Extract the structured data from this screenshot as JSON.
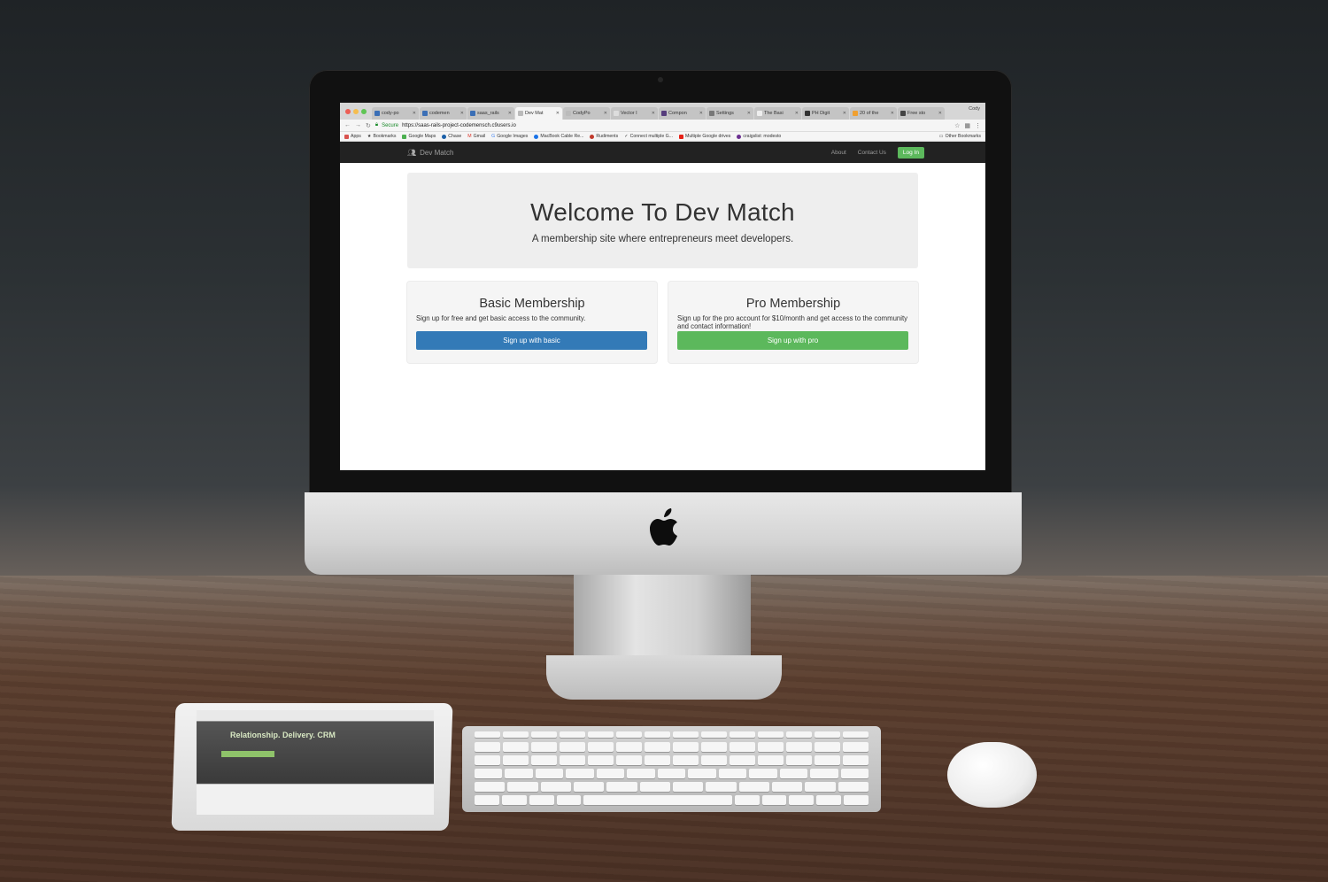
{
  "browser": {
    "tabs": [
      {
        "label": "cody-po",
        "active": false
      },
      {
        "label": "codemen",
        "active": false
      },
      {
        "label": "saas_rails",
        "active": false
      },
      {
        "label": "Dev Mat",
        "active": true
      },
      {
        "label": "CodyPo",
        "active": false
      },
      {
        "label": "Vector I",
        "active": false
      },
      {
        "label": "Compon",
        "active": false
      },
      {
        "label": "Settings",
        "active": false
      },
      {
        "label": "The Basi",
        "active": false
      },
      {
        "label": "PH Digit",
        "active": false
      },
      {
        "label": "20 of the",
        "active": false
      },
      {
        "label": "Free sto",
        "active": false
      }
    ],
    "user_chip": "Cody",
    "secure_label": "Secure",
    "url": "https://saas-rails-project-codemensch.c9users.io",
    "bookmarks": [
      {
        "label": "Apps",
        "color": "#d9534f"
      },
      {
        "label": "Bookmarks",
        "color": "#666666"
      },
      {
        "label": "Google Maps",
        "color": "#4caf50"
      },
      {
        "label": "Chase",
        "color": "#1a5fa8"
      },
      {
        "label": "Gmail",
        "color": "#d93025"
      },
      {
        "label": "Google Images",
        "color": "#4285f4"
      },
      {
        "label": "MacBook Cable Re...",
        "color": "#1a73e8"
      },
      {
        "label": "Rudiments",
        "color": "#c0392b"
      },
      {
        "label": "Connect multiple G...",
        "color": "#888888"
      },
      {
        "label": "Multiple Google drives",
        "color": "#e62117"
      },
      {
        "label": "craigslist: modesto",
        "color": "#6b2f91"
      }
    ],
    "other_bookmarks": "Other Bookmarks"
  },
  "site": {
    "brand": "Dev Match",
    "nav": {
      "about": "About",
      "contact": "Contact Us",
      "login": "Log In"
    },
    "jumbotron": {
      "title": "Welcome To Dev Match",
      "subtitle": "A membership site where entrepreneurs meet developers."
    },
    "basic": {
      "title": "Basic Membership",
      "description": "Sign up for free and get basic access to the community.",
      "button": "Sign up with basic"
    },
    "pro": {
      "title": "Pro Membership",
      "description": "Sign up for the pro account for $10/month and get access to the community and contact information!",
      "button": "Sign up with pro"
    }
  },
  "ipad": {
    "headline": "Relationship. Delivery. CRM"
  },
  "colors": {
    "navbar": "#222222",
    "success_green": "#5cb85c",
    "primary_blue": "#337ab7",
    "jumbotron_bg": "#eeeeee"
  }
}
